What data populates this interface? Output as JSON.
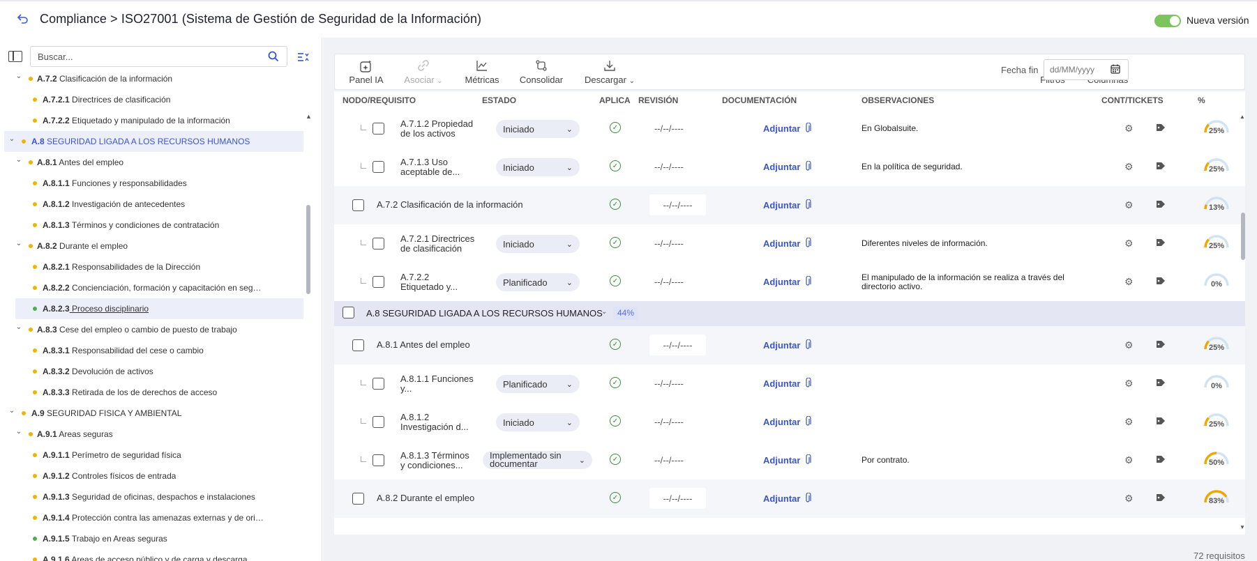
{
  "header": {
    "breadcrumb": "Compliance > ISO27001 (Sistema de Gestión de Seguridad de la Información)",
    "toggle_label": "Nueva versión",
    "toggle_on": true,
    "accent_color": "#7cc45c"
  },
  "left_panel": {
    "search_placeholder": "Buscar...",
    "tree": [
      {
        "code": "A.7.2",
        "label": "Clasificación de la información",
        "level": 2,
        "dot": "#f0b400",
        "expanded": true
      },
      {
        "code": "A.7.2.1",
        "label": "Directrices de clasificación",
        "level": 3,
        "dot": "#f0b400"
      },
      {
        "code": "A.7.2.2",
        "label": "Etiquetado y manipulado de la información",
        "level": 3,
        "dot": "#f0b400"
      },
      {
        "code": "A.8",
        "label": "SEGURIDAD LIGADA A LOS RECURSOS HUMANOS",
        "level": 1,
        "dot": "#f0b400",
        "expanded": true,
        "selected": true
      },
      {
        "code": "A.8.1",
        "label": "Antes del empleo",
        "level": 2,
        "dot": "#f0b400",
        "expanded": true
      },
      {
        "code": "A.8.1.1",
        "label": "Funciones y responsabilidades",
        "level": 3,
        "dot": "#f0b400"
      },
      {
        "code": "A.8.1.2",
        "label": "Investigación de antecedentes",
        "level": 3,
        "dot": "#f0b400"
      },
      {
        "code": "A.8.1.3",
        "label": "Términos y condiciones de contratación",
        "level": 3,
        "dot": "#f0b400"
      },
      {
        "code": "A.8.2",
        "label": "Durante el empleo",
        "level": 2,
        "dot": "#f0b400",
        "expanded": true
      },
      {
        "code": "A.8.2.1",
        "label": "Responsabilidades de la Dirección",
        "level": 3,
        "dot": "#f0b400"
      },
      {
        "code": "A.8.2.2",
        "label": "Concienciación, formación y capacitación en seguridad ...",
        "level": 3,
        "dot": "#f0b400"
      },
      {
        "code": "A.8.2.3",
        "label": "Proceso disciplinario",
        "level": 3,
        "dot": "#4caf50",
        "highlighted": true
      },
      {
        "code": "A.8.3",
        "label": "Cese del empleo o cambio de puesto de trabajo",
        "level": 2,
        "dot": "#f0b400",
        "expanded": true
      },
      {
        "code": "A.8.3.1",
        "label": "Responsabilidad del cese o cambio",
        "level": 3,
        "dot": "#f0b400"
      },
      {
        "code": "A.8.3.2",
        "label": "Devolución de activos",
        "level": 3,
        "dot": "#f0b400"
      },
      {
        "code": "A.8.3.3",
        "label": "Retirada de los de derechos de acceso",
        "level": 3,
        "dot": "#f0b400"
      },
      {
        "code": "A.9",
        "label": "SEGURIDAD FISICA Y AMBIENTAL",
        "level": 1,
        "dot": "#f0b400",
        "expanded": true
      },
      {
        "code": "A.9.1",
        "label": "Areas seguras",
        "level": 2,
        "dot": "#f0b400",
        "expanded": true
      },
      {
        "code": "A.9.1.1",
        "label": "Perímetro de seguridad física",
        "level": 3,
        "dot": "#f0b400"
      },
      {
        "code": "A.9.1.2",
        "label": "Controles físicos de entrada",
        "level": 3,
        "dot": "#f0b400"
      },
      {
        "code": "A.9.1.3",
        "label": "Seguridad de oficinas, despachos e instalaciones",
        "level": 3,
        "dot": "#f0b400"
      },
      {
        "code": "A.9.1.4",
        "label": "Protección contra las amenazas externas y de origen am...",
        "level": 3,
        "dot": "#f0b400"
      },
      {
        "code": "A.9.1.5",
        "label": "Trabajo en Areas seguras",
        "level": 3,
        "dot": "#4caf50"
      },
      {
        "code": "A.9.1.6",
        "label": "Areas de acceso público y de carga y descarga",
        "level": 3,
        "dot": "#f0b400"
      }
    ]
  },
  "toolbar": {
    "panel_ia": "Panel IA",
    "asociar": "Asociar",
    "metricas": "Métricas",
    "consolidar": "Consolidar",
    "descargar": "Descargar",
    "fecha_label": "Fecha fin",
    "fecha_placeholder": "dd/MM/yyyy",
    "filtros": "Filtros",
    "columnas": "Columnas"
  },
  "table": {
    "headers": {
      "nodo": "NODO/REQUISITO",
      "estado": "ESTADO",
      "aplica": "APLICA",
      "revision": "REVISIÓN",
      "documentacion": "DOCUMENTACIÓN",
      "observaciones": "OBSERVACIONES",
      "cont": "CONT/TICKETS",
      "pct": "%"
    },
    "adjuntar_label": "Adjuntar",
    "revision_empty": "--/--/----",
    "rows": [
      {
        "kind": "leaf",
        "name_l1": "A.7.1.2 Propiedad",
        "name_l2": "de los activos",
        "estado": "Iniciado",
        "obs_l1": "En Globalsuite.",
        "obs_l2": "",
        "pct": 25,
        "pct_label": "25%"
      },
      {
        "kind": "leaf",
        "name_l1": "A.7.1.3 Uso",
        "name_l2": "aceptable de...",
        "estado": "Iniciado",
        "obs_l1": "En la política de seguridad.",
        "obs_l2": "",
        "pct": 25,
        "pct_label": "25%"
      },
      {
        "kind": "group",
        "name_l1": "A.7.2 Clasificación de la información",
        "name_l2": "",
        "estado": "",
        "obs_l1": "",
        "obs_l2": "",
        "pct": 13,
        "pct_label": "13%"
      },
      {
        "kind": "leaf",
        "name_l1": "A.7.2.1 Directrices",
        "name_l2": "de clasificación",
        "estado": "Iniciado",
        "obs_l1": "Diferentes niveles de información.",
        "obs_l2": "",
        "pct": 25,
        "pct_label": "25%"
      },
      {
        "kind": "leaf",
        "name_l1": "A.7.2.2",
        "name_l2": "Etiquetado y...",
        "estado": "Planificado",
        "obs_l1": "El manipulado de la información se realiza a través del",
        "obs_l2": "directorio activo.",
        "pct": 0,
        "pct_label": "0%"
      },
      {
        "kind": "section",
        "name_l1": "A.8 SEGURIDAD LIGADA A LOS RECURSOS HUMANOS",
        "badge": "44%"
      },
      {
        "kind": "group",
        "name_l1": "A.8.1 Antes del empleo",
        "name_l2": "",
        "estado": "",
        "obs_l1": "",
        "obs_l2": "",
        "pct": 25,
        "pct_label": "25%"
      },
      {
        "kind": "leaf",
        "name_l1": "A.8.1.1 Funciones",
        "name_l2": "y...",
        "estado": "Planificado",
        "obs_l1": "",
        "obs_l2": "",
        "pct": 0,
        "pct_label": "0%"
      },
      {
        "kind": "leaf",
        "name_l1": "A.8.1.2",
        "name_l2": "Investigación d...",
        "estado": "Iniciado",
        "obs_l1": "",
        "obs_l2": "",
        "pct": 25,
        "pct_label": "25%"
      },
      {
        "kind": "leaf",
        "name_l1": "A.8.1.3 Términos",
        "name_l2": "y condiciones...",
        "estado": "Implementado sin documentar",
        "obs_l1": "Por contrato.",
        "obs_l2": "",
        "pct": 50,
        "pct_label": "50%"
      },
      {
        "kind": "group",
        "name_l1": "A.8.2 Durante el empleo",
        "name_l2": "",
        "estado": "",
        "obs_l1": "",
        "obs_l2": "",
        "pct": 83,
        "pct_label": "83%"
      }
    ]
  },
  "footer": {
    "count": "72 requisitos"
  },
  "colors": {
    "link_blue": "#3b55c6",
    "status_green": "#3a8a3a",
    "gauge_orange": "#f0a800",
    "gauge_track": "#cfe3f3"
  }
}
